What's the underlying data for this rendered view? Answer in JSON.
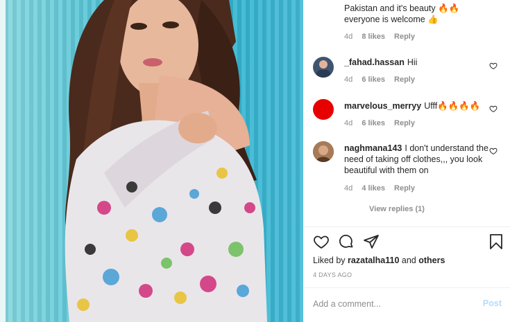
{
  "post_image": {
    "alt": ""
  },
  "comments": [
    {
      "username": "",
      "text_lines": [
        "Pakistan and it's beauty 🔥🔥",
        "everyone is welcome 👍"
      ],
      "time": "4d",
      "likes": "8 likes",
      "reply": "Reply",
      "avatar_color": "#ffffff"
    },
    {
      "username": "_fahad.hassan",
      "text": "Hii",
      "time": "4d",
      "likes": "6 likes",
      "reply": "Reply",
      "avatar_color": "#3f5470"
    },
    {
      "username": "marvelous_merryy",
      "text": "Ufff🔥🔥🔥🔥",
      "time": "4d",
      "likes": "6 likes",
      "reply": "Reply",
      "avatar_color": "#e60000"
    },
    {
      "username": "naghmana143",
      "text": "I don't understand the need of taking off clothes,,, you look beautiful with them on",
      "time": "4d",
      "likes": "4 likes",
      "reply": "Reply",
      "avatar_color": "#8a5a3c"
    }
  ],
  "view_replies": "View replies (1)",
  "actions": {
    "like_icon": "heart-icon",
    "comment_icon": "comment-bubble-icon",
    "share_icon": "paper-plane-icon",
    "save_icon": "bookmark-icon"
  },
  "liked_by": {
    "prefix": "Liked by",
    "user": "razatalha110",
    "and": "and",
    "others": "others"
  },
  "timestamp": "4 DAYS AGO",
  "comment_input": {
    "placeholder": "Add a comment...",
    "post_label": "Post"
  },
  "colors": {
    "text": "#262626",
    "muted": "#8e8e8e",
    "post_disabled": "#b3dbff",
    "divider": "#efefef"
  }
}
